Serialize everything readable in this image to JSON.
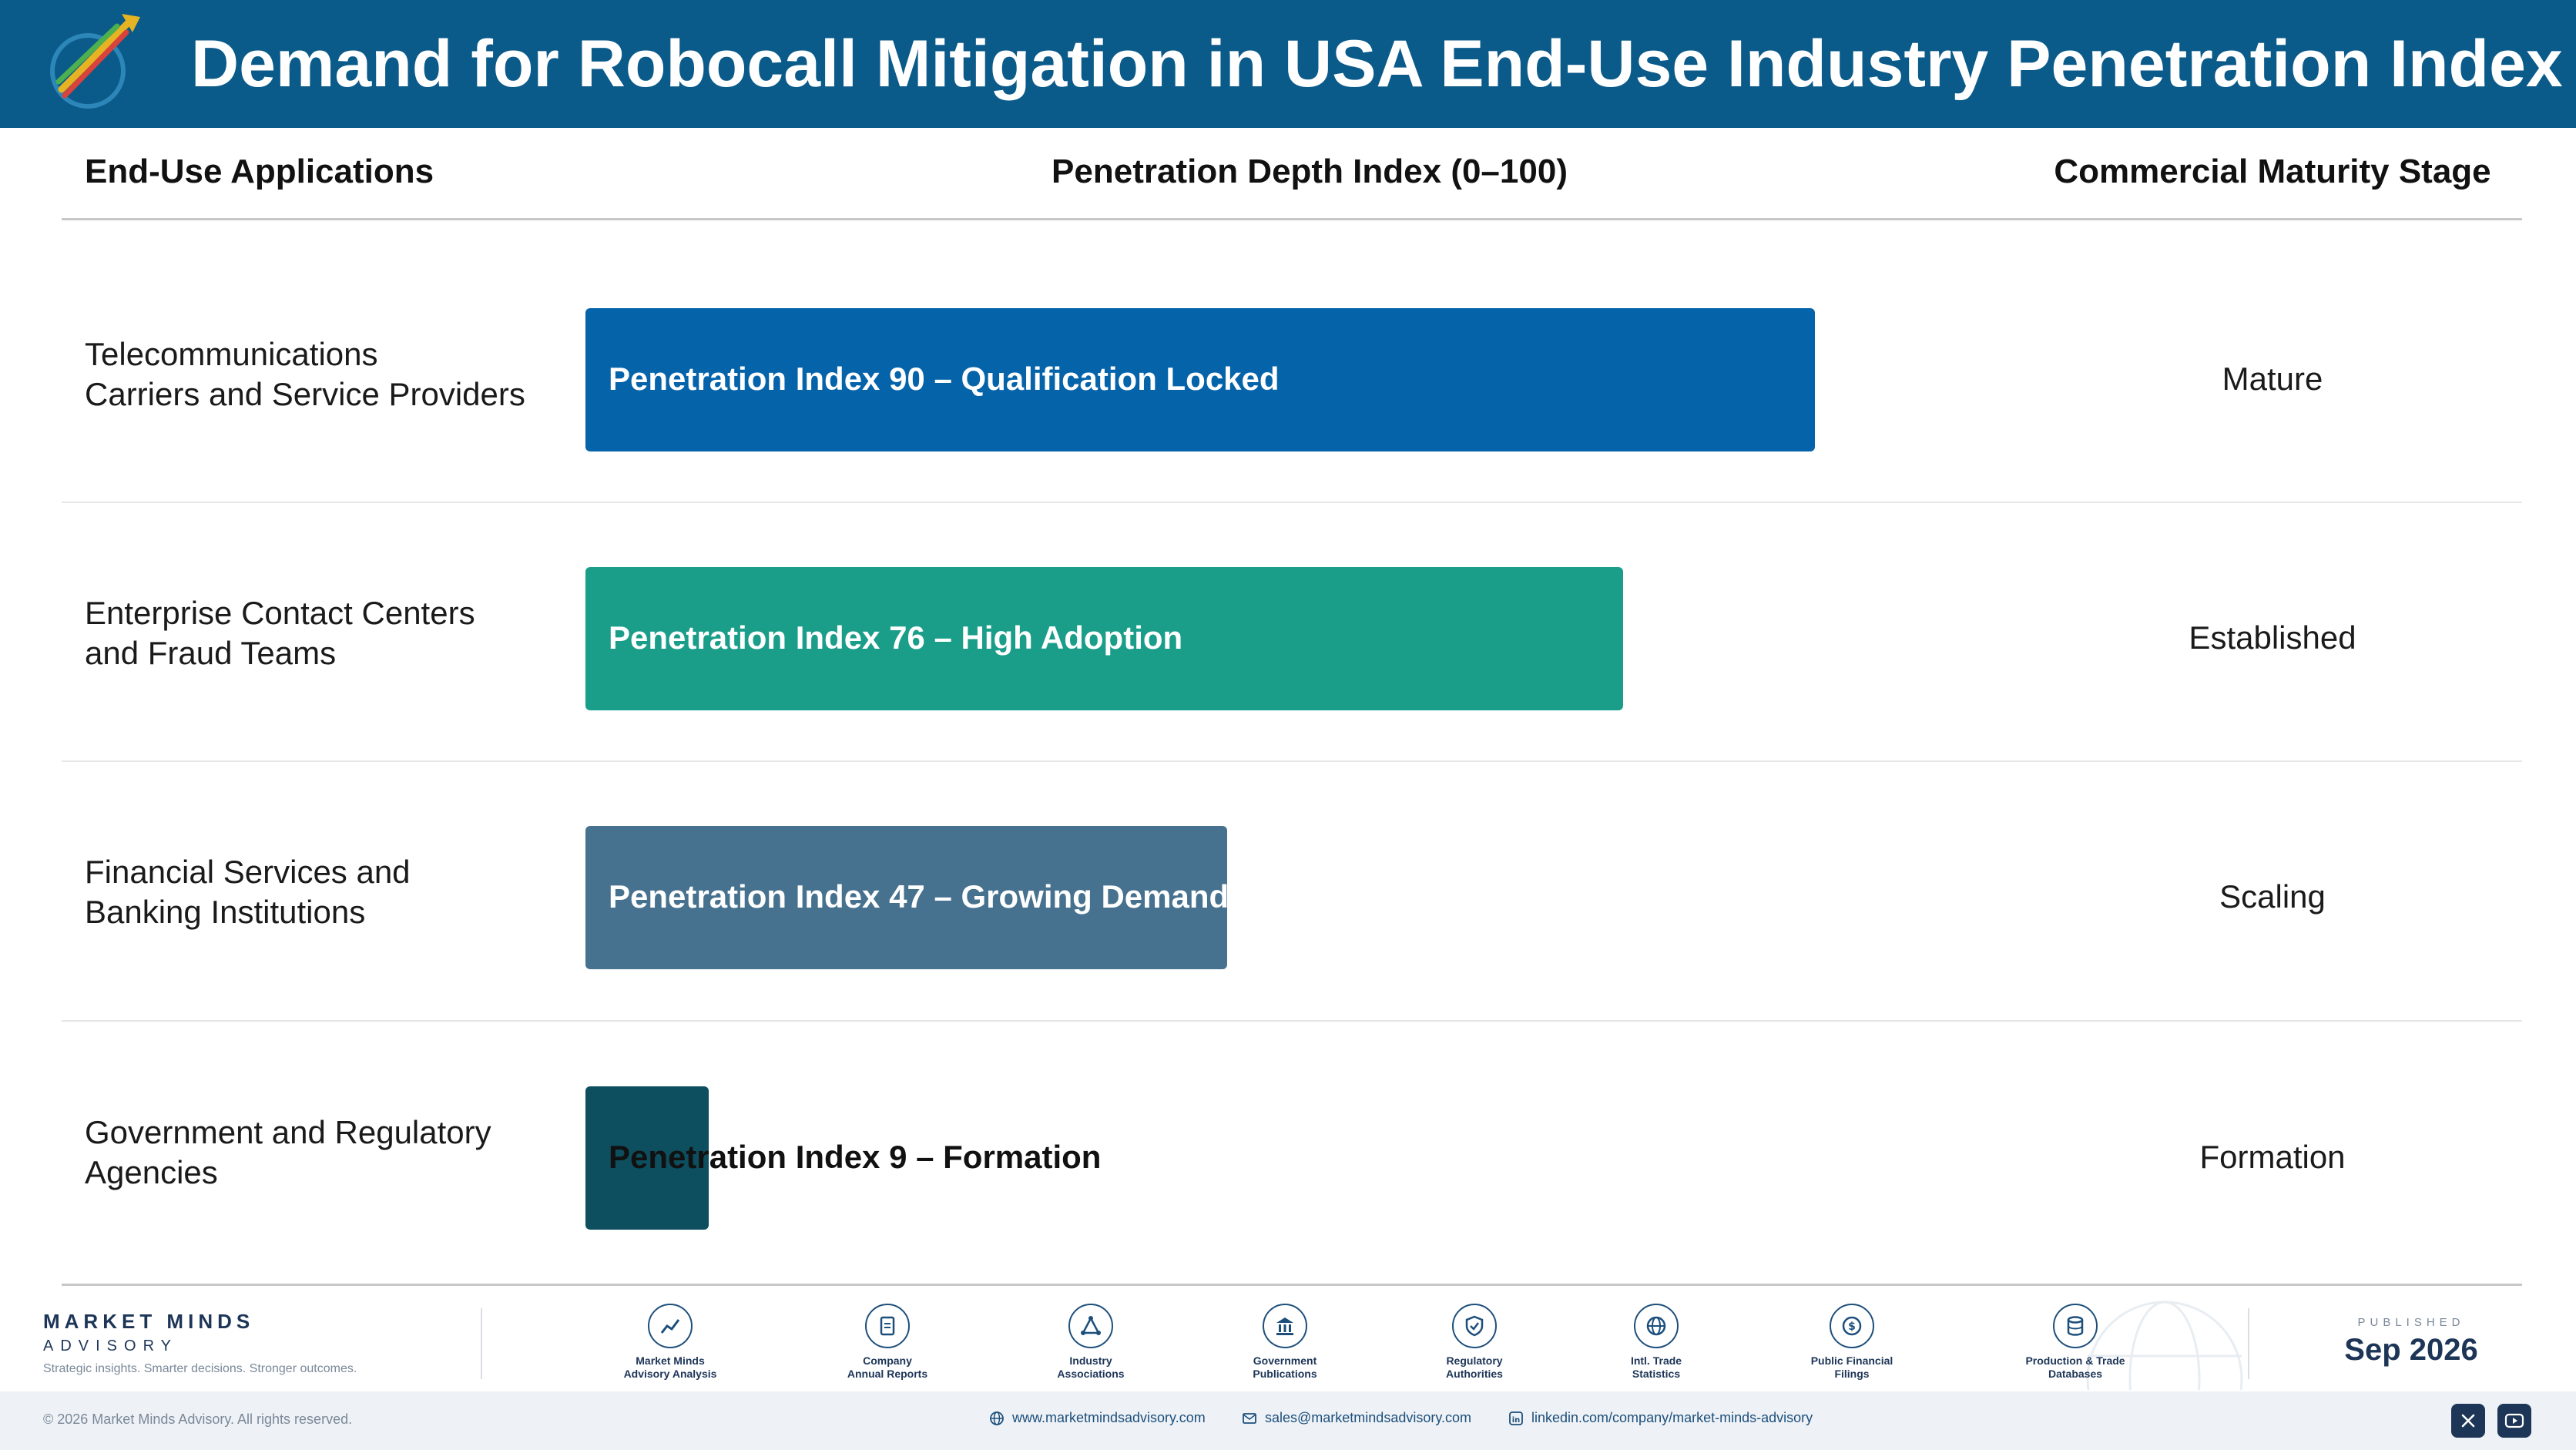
{
  "header": {
    "title": "Demand for Robocall Mitigation in USA End-Use Industry Penetration Index"
  },
  "columns": {
    "applications": "End-Use Applications",
    "depth": "Penetration Depth Index (0–100)",
    "maturity": "Commercial Maturity Stage"
  },
  "chart_data": {
    "type": "bar",
    "orientation": "horizontal",
    "xlim": [
      0,
      100
    ],
    "categories": [
      "Telecommunications Carriers and Service Providers",
      "Enterprise Contact Centers and Fraud Teams",
      "Financial Services and Banking Institutions",
      "Government and Regulatory Agencies"
    ],
    "rows": [
      {
        "app_line1": "Telecommunications",
        "app_line2": "Carriers and Service Providers",
        "value": 90,
        "label": "Penetration Index 90 – Qualification Locked",
        "stage": "Mature",
        "color": "#0563aa"
      },
      {
        "app_line1": "Enterprise Contact Centers",
        "app_line2": "and Fraud Teams",
        "value": 76,
        "label": "Penetration Index 76 – High Adoption",
        "stage": "Established",
        "color": "#1a9e8a"
      },
      {
        "app_line1": "Financial Services and",
        "app_line2": "Banking Institutions",
        "value": 47,
        "label": "Penetration Index 47 – Growing Demand",
        "stage": "Scaling",
        "color": "#46718f"
      },
      {
        "app_line1": "Government and Regulatory",
        "app_line2": "Agencies",
        "value": 9,
        "label": "Penetration Index 9 – Formation",
        "stage": "Formation",
        "color": "#0d4f5e"
      }
    ]
  },
  "footer": {
    "brand_name": "MARKET MINDS",
    "brand_sub": "ADVISORY",
    "tagline": "Strategic insights. Smarter decisions. Stronger outcomes.",
    "sources": [
      {
        "line1": "Market Minds",
        "line2": "Advisory Analysis",
        "icon": "chart-line-icon"
      },
      {
        "line1": "Company",
        "line2": "Annual Reports",
        "icon": "document-icon"
      },
      {
        "line1": "Industry",
        "line2": "Associations",
        "icon": "network-icon"
      },
      {
        "line1": "Government",
        "line2": "Publications",
        "icon": "building-icon"
      },
      {
        "line1": "Regulatory",
        "line2": "Authorities",
        "icon": "shield-icon"
      },
      {
        "line1": "Intl. Trade",
        "line2": "Statistics",
        "icon": "globe-icon"
      },
      {
        "line1": "Public Financial",
        "line2": "Filings",
        "icon": "coin-icon"
      },
      {
        "line1": "Production & Trade",
        "line2": "Databases",
        "icon": "database-icon"
      }
    ],
    "published_label": "PUBLISHED",
    "published_date": "Sep 2026",
    "copyright": "© 2026 Market Minds Advisory. All rights reserved.",
    "website": "www.marketmindsadvisory.com",
    "email": "sales@marketmindsadvisory.com",
    "linkedin": "linkedin.com/company/market-minds-advisory"
  },
  "colors": {
    "header": "#0a5a8a",
    "navy": "#1d3557"
  }
}
